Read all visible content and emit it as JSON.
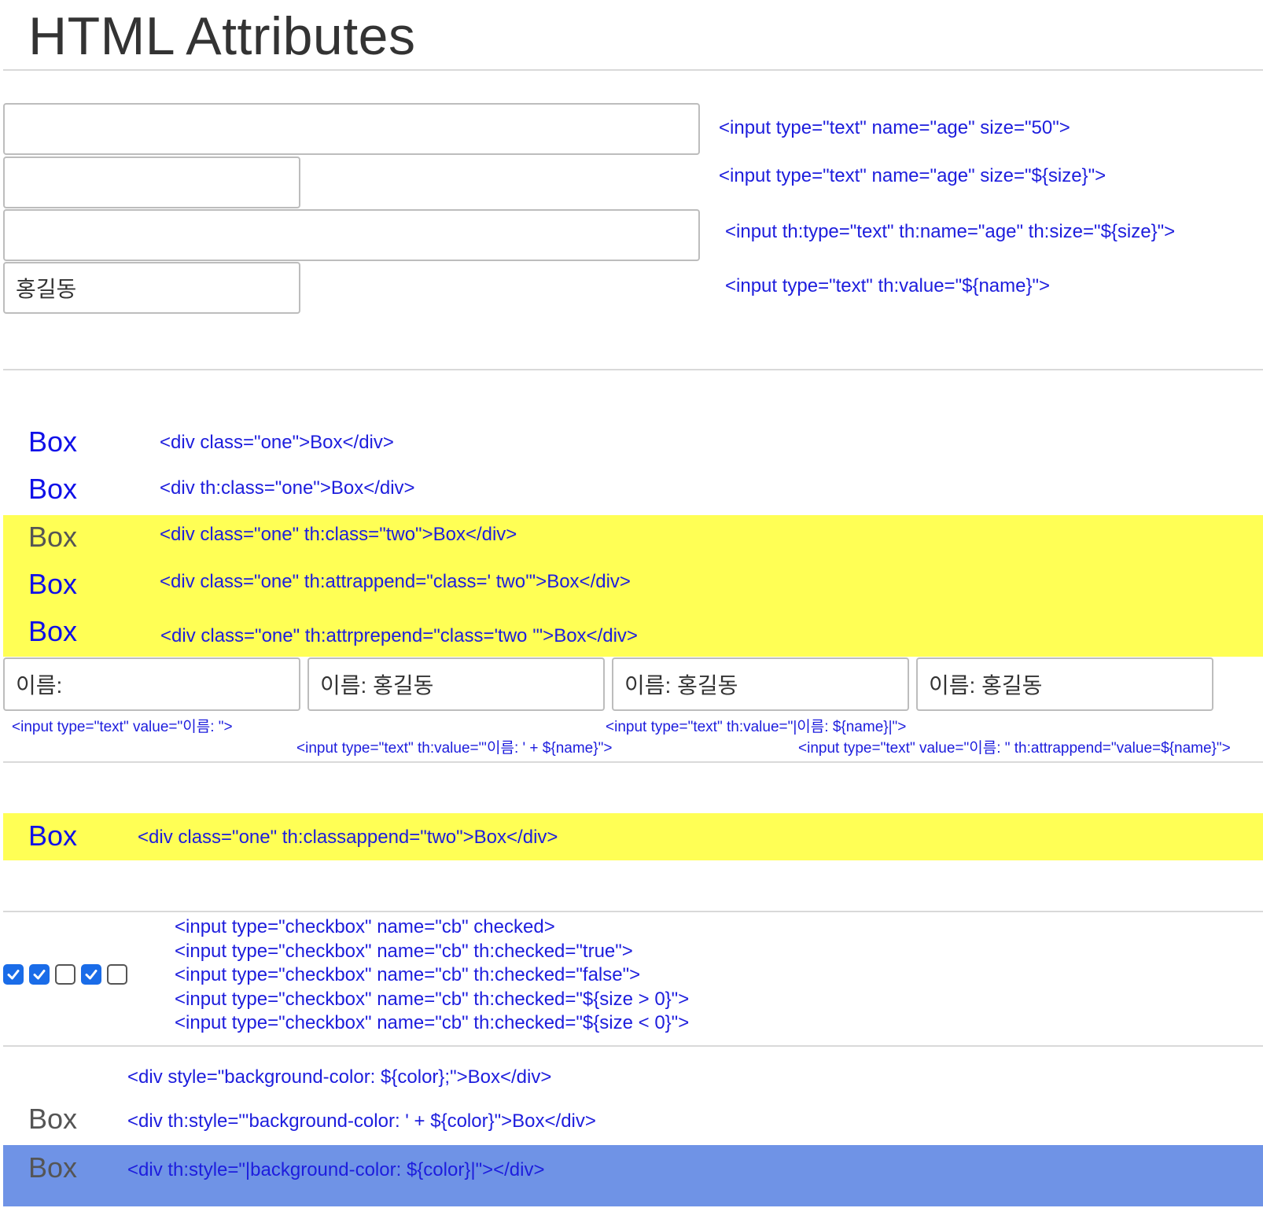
{
  "page": {
    "title": "HTML Attributes"
  },
  "section_inputs": {
    "input_values": [
      "",
      "",
      "",
      "홍길동"
    ],
    "codes": [
      "<input type=\"text\" name=\"age\" size=\"50\">",
      "<input type=\"text\" name=\"age\" size=\"${size}\">",
      "<input th:type=\"text\" th:name=\"age\" th:size=\"${size}\">",
      "<input type=\"text\" th:value=\"${name}\">"
    ]
  },
  "section_class": {
    "boxes": [
      {
        "label": "Box",
        "code": "<div class=\"one\">Box</div>"
      },
      {
        "label": "Box",
        "code": "<div th:class=\"one\">Box</div>"
      },
      {
        "label": "Box",
        "code": "<div class=\"one\" th:class=\"two\">Box</div>"
      },
      {
        "label": "Box",
        "code": "<div class=\"one\" th:attrappend=\"class=' two'\">Box</div>"
      },
      {
        "label": "Box",
        "code": "<div class=\"one\" th:attrprepend=\"class='two '\">Box</div>"
      }
    ],
    "highlight_color": "#ffff55",
    "one_color": "#1010e8"
  },
  "section_values": {
    "inputs": [
      "이름:",
      "이름: 홍길동",
      "이름: 홍길동",
      "이름: 홍길동"
    ],
    "codes": [
      "<input type=\"text\" value=\"이름: \">",
      "<input type=\"text\" th:value=\"'이름: ' + ${name}\">",
      "<input type=\"text\" th:value=\"|이름: ${name}|\">",
      "<input type=\"text\" value=\"이름: \" th:attrappend=\"value=${name}\">"
    ]
  },
  "section_classappend": {
    "label": "Box",
    "code": "<div class=\"one\" th:classappend=\"two\">Box</div>"
  },
  "section_checkbox": {
    "states": [
      true,
      true,
      false,
      true,
      false
    ],
    "codes": [
      "<input type=\"checkbox\" name=\"cb\" checked>",
      "<input type=\"checkbox\" name=\"cb\" th:checked=\"true\">",
      "<input type=\"checkbox\" name=\"cb\" th:checked=\"false\">",
      "<input type=\"checkbox\" name=\"cb\" th:checked=\"${size > 0}\">",
      "<input type=\"checkbox\" name=\"cb\" th:checked=\"${size < 0}\">"
    ],
    "checked_color": "#1a6ce8"
  },
  "section_style": {
    "rows": [
      {
        "label": "",
        "code": "<div style=\"background-color: ${color};\">Box</div>"
      },
      {
        "label": "Box",
        "code": "<div th:style=\"'background-color: ' + ${color}\">Box</div>"
      },
      {
        "label": "Box",
        "code": "<div th:style=\"|background-color: ${color}|\"></div>"
      }
    ],
    "color_box_bg": "#6f93e6"
  }
}
